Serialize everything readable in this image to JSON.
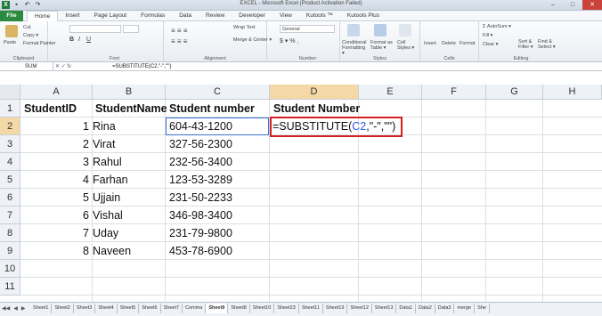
{
  "window": {
    "title": "EXCEL - Microsoft Excel (Product Activation Failed)",
    "logo": "X",
    "min": "–",
    "max": "□",
    "close": "✕"
  },
  "menu": {
    "file": "File",
    "tabs": [
      "Home",
      "Insert",
      "Page Layout",
      "Formulas",
      "Data",
      "Review",
      "Developer",
      "View",
      "Kutools ™",
      "Kutools Plus"
    ]
  },
  "ribbon": {
    "clipboard": {
      "paste": "Paste",
      "cut": "Cut",
      "copy": "Copy ▾",
      "painter": "Format Painter",
      "label": "Clipboard"
    },
    "font": {
      "label": "Font"
    },
    "alignment": {
      "wrap": "Wrap Text",
      "merge": "Merge & Center ▾",
      "label": "Alignment"
    },
    "number": {
      "format": "General",
      "label": "Number"
    },
    "styles": {
      "cond": "Conditional Formatting ▾",
      "table": "Format as Table ▾",
      "cell": "Cell Styles ▾",
      "label": "Styles"
    },
    "cells": {
      "insert": "Insert",
      "delete": "Delete",
      "format": "Format",
      "label": "Cells"
    },
    "editing": {
      "autosum": "Σ AutoSum ▾",
      "fill": "Fill ▾",
      "clear": "Clear ▾",
      "sort": "Sort & Filter ▾",
      "find": "Find & Select ▾",
      "label": "Editing"
    }
  },
  "formula_bar": {
    "name_box": "SUM",
    "icons": "✕ ✓ fx",
    "content": "=SUBSTITUTE(C2,\"-\",\"\")"
  },
  "columns": [
    "A",
    "B",
    "C",
    "D",
    "E",
    "F",
    "G",
    "H"
  ],
  "rows": [
    "1",
    "2",
    "3",
    "4",
    "5",
    "6",
    "7",
    "8",
    "9",
    "10",
    "11"
  ],
  "sheet": {
    "headers": [
      "StudentID",
      "StudentName",
      "Student number",
      "Student Number"
    ],
    "rows": [
      {
        "id": "1",
        "name": "Rina",
        "number": "604-43-1200"
      },
      {
        "id": "2",
        "name": "Virat",
        "number": "327-56-2300"
      },
      {
        "id": "3",
        "name": "Rahul",
        "number": "232-56-3400"
      },
      {
        "id": "4",
        "name": "Farhan",
        "number": "123-53-3289"
      },
      {
        "id": "5",
        "name": "Ujjain",
        "number": "231-50-2233"
      },
      {
        "id": "6",
        "name": "Vishal",
        "number": "346-98-3400"
      },
      {
        "id": "7",
        "name": "Uday",
        "number": "231-79-9800"
      },
      {
        "id": "8",
        "name": "Naveen",
        "number": "453-78-6900"
      }
    ],
    "editing_formula": {
      "prefix": "=SUBSTITUTE(",
      "ref": "C2",
      "suffix": ",\"-\",\"\")"
    }
  },
  "sheet_tabs": [
    "Sheet1",
    "Sheet2",
    "Sheet3",
    "Sheet4",
    "Sheet5",
    "Sheet6",
    "Sheet7",
    "Comma",
    "Sheet9",
    "Sheet8",
    "Sheet10",
    "Sheet23",
    "Sheet11",
    "Sheet19",
    "Sheet12",
    "Sheet13",
    "Data1",
    "Data2",
    "Data3",
    "merge",
    "She"
  ],
  "active_sheet": "Sheet9",
  "colors": {
    "accent": "#2b8a3e",
    "select": "#3b6fd1",
    "highlight_box": "#d62020",
    "ref": "#2d5be3"
  }
}
